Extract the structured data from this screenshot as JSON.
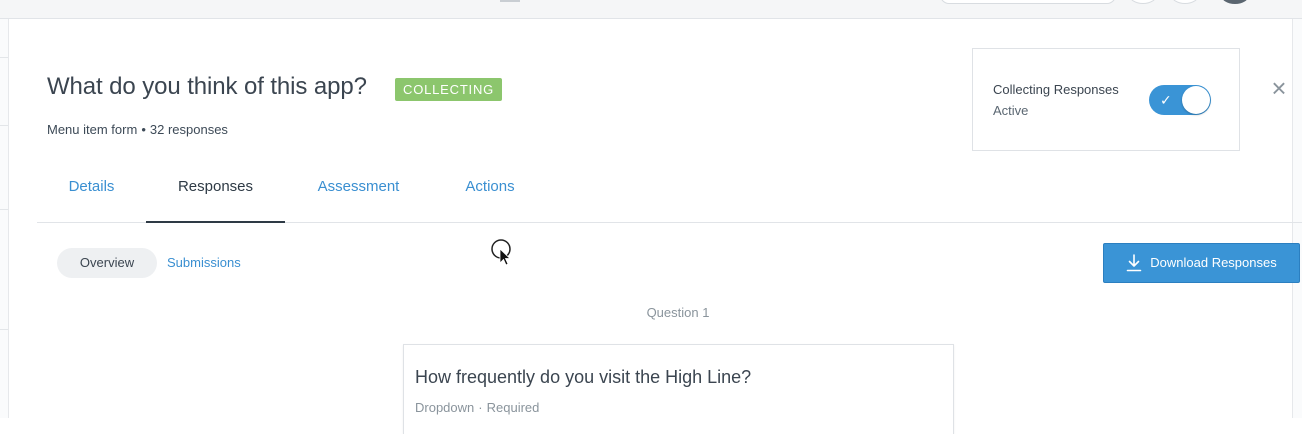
{
  "form": {
    "title": "What do you think of this app?",
    "status_badge": "COLLECTING",
    "subtitle_type": "Menu item form",
    "subtitle_sep": "•",
    "subtitle_count": "32 responses"
  },
  "collecting": {
    "label": "Collecting Responses",
    "status": "Active",
    "toggle_on": true,
    "check_glyph": "✓"
  },
  "close_glyph": "×",
  "tabs": [
    {
      "label": "Details",
      "active": false
    },
    {
      "label": "Responses",
      "active": true
    },
    {
      "label": "Assessment",
      "active": false
    },
    {
      "label": "Actions",
      "active": false
    }
  ],
  "subnav": {
    "overview": "Overview",
    "submissions": "Submissions"
  },
  "download": {
    "label": "Download Responses",
    "icon": "download-icon"
  },
  "question": {
    "number_label": "Question 1",
    "text": "How frequently do you visit the High Line?",
    "type": "Dropdown",
    "sep": "·",
    "required": "Required"
  },
  "colors": {
    "accent": "#3a94d6",
    "badge_green": "#8cc66d",
    "text_dark": "#3b4550",
    "text_muted": "#8a949c"
  }
}
